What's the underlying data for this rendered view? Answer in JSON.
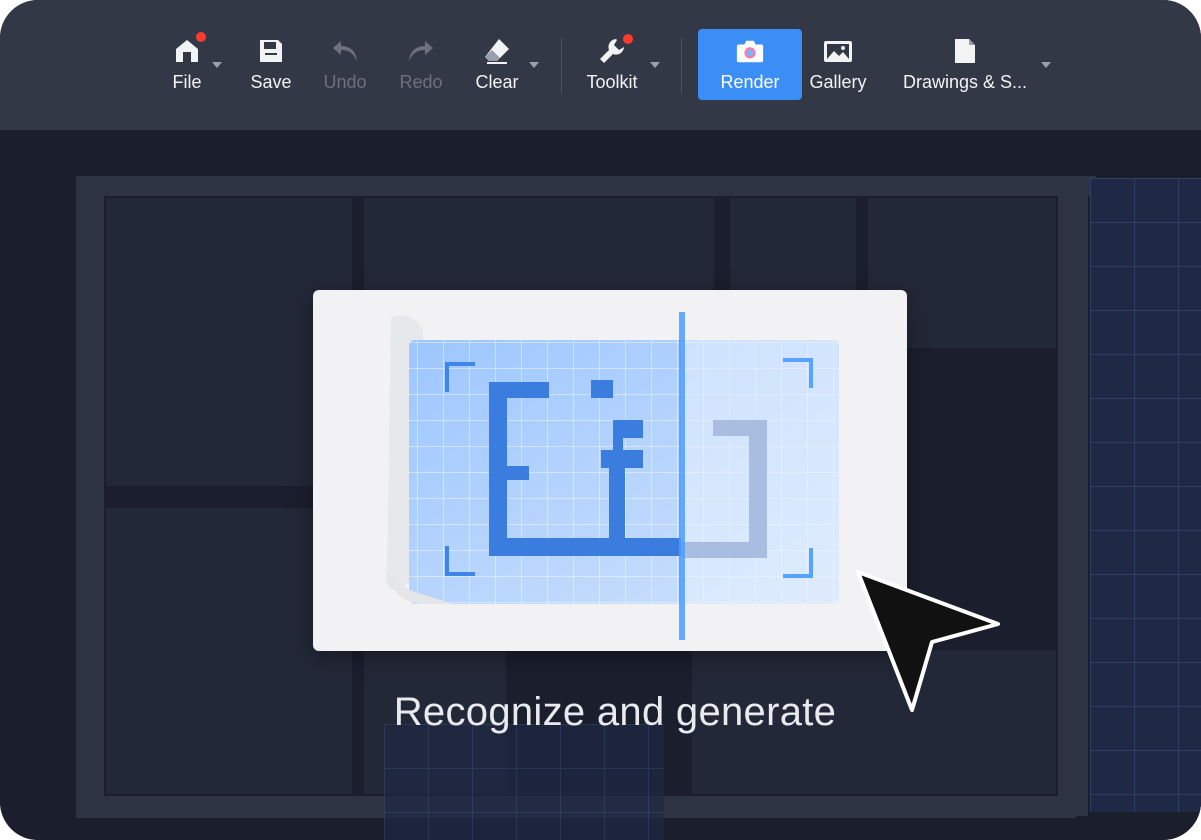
{
  "toolbar": {
    "items": [
      {
        "label": "File",
        "icon": "home-icon",
        "has_dropdown": true,
        "has_badge": true
      },
      {
        "label": "Save",
        "icon": "save-icon"
      },
      {
        "label": "Undo",
        "icon": "undo-icon",
        "disabled": true
      },
      {
        "label": "Redo",
        "icon": "redo-icon",
        "disabled": true
      },
      {
        "label": "Clear",
        "icon": "eraser-icon",
        "has_dropdown": true
      },
      {
        "label": "Toolkit",
        "icon": "wrench-icon",
        "has_dropdown": true,
        "has_badge": true
      },
      {
        "label": "Render",
        "icon": "camera-icon",
        "active": true
      },
      {
        "label": "Gallery",
        "icon": "image-icon"
      },
      {
        "label": "Drawings & S...",
        "icon": "document-icon",
        "has_dropdown": true
      }
    ]
  },
  "overlay": {
    "caption": "Recognize and generate",
    "illustration": "blueprint-recognition-icon",
    "cursor": "pointer-cursor-icon"
  },
  "colors": {
    "toolbar_bg": "#323845",
    "canvas_bg": "#1b1f2d",
    "accent": "#3a8ef6",
    "badge": "#ff3b30",
    "disabled_text": "#6c717c"
  }
}
